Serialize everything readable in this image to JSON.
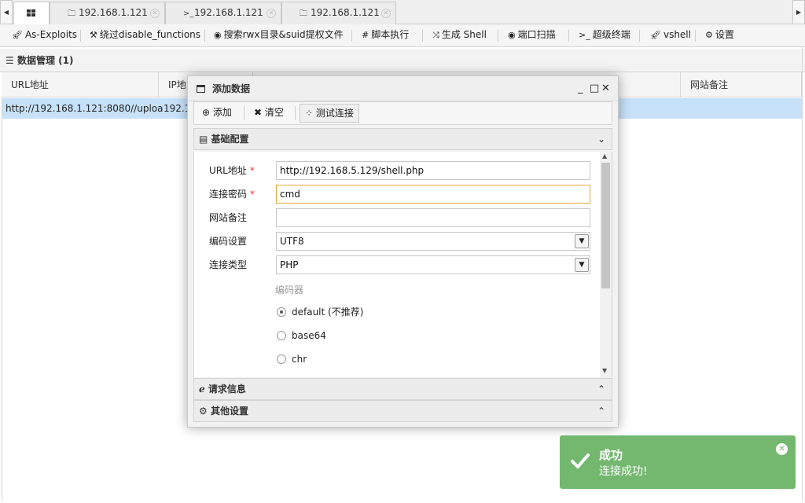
{
  "tabs": [
    {
      "icon": "grid-icon",
      "label": ""
    },
    {
      "icon": "folder-icon",
      "label": "192.168.1.121"
    },
    {
      "icon": "terminal-icon",
      "label": "192.168.1.121"
    },
    {
      "icon": "folder-icon",
      "label": "192.168.1.121"
    }
  ],
  "toolbar": {
    "items": [
      {
        "icon": "rocket-icon",
        "label": "As-Exploits"
      },
      {
        "icon": "hammer-icon",
        "label": "绕过disable_functions"
      },
      {
        "icon": "eye-icon",
        "label": "搜索rwx目录&suid提权文件"
      },
      {
        "icon": "hash-icon",
        "label": "脚本执行"
      },
      {
        "icon": "shuffle-icon",
        "label": "生成 Shell"
      },
      {
        "icon": "eye-icon",
        "label": "端口扫描"
      },
      {
        "icon": "terminal-icon",
        "label": "超级终端"
      },
      {
        "icon": "rocket-icon",
        "label": "vshell"
      },
      {
        "icon": "gear-icon",
        "label": "设置"
      }
    ]
  },
  "data_manager": {
    "title": "数据管理 (1)",
    "columns": [
      "URL地址",
      "IP地",
      "网站备注"
    ],
    "rows": [
      {
        "url": "http://192.168.1.121:8080//uploa",
        "ip": "192.1"
      }
    ]
  },
  "dialog": {
    "title": "添加数据",
    "controls": {
      "minimize": "_",
      "maximize": "□",
      "close": "✕"
    },
    "tools": {
      "add": "添加",
      "clear": "清空",
      "test": "测试连接"
    },
    "basic_section": {
      "title": "基础配置",
      "fields": {
        "url": {
          "label": "URL地址",
          "required": "*",
          "value": "http://192.168.5.129/shell.php"
        },
        "password": {
          "label": "连接密码",
          "required": "*",
          "value": "cmd"
        },
        "note": {
          "label": "网站备注",
          "value": ""
        },
        "encoding": {
          "label": "编码设置",
          "value": "UTF8"
        },
        "conn_type": {
          "label": "连接类型",
          "value": "PHP"
        }
      },
      "encoder": {
        "label": "编码器",
        "options": [
          "default (不推荐)",
          "base64",
          "chr"
        ],
        "selected": "default (不推荐)"
      }
    },
    "request_section": {
      "title": "请求信息"
    },
    "other_section": {
      "title": "其他设置"
    }
  },
  "toast": {
    "title": "成功",
    "message": "连接成功!",
    "color": "#74b870"
  }
}
